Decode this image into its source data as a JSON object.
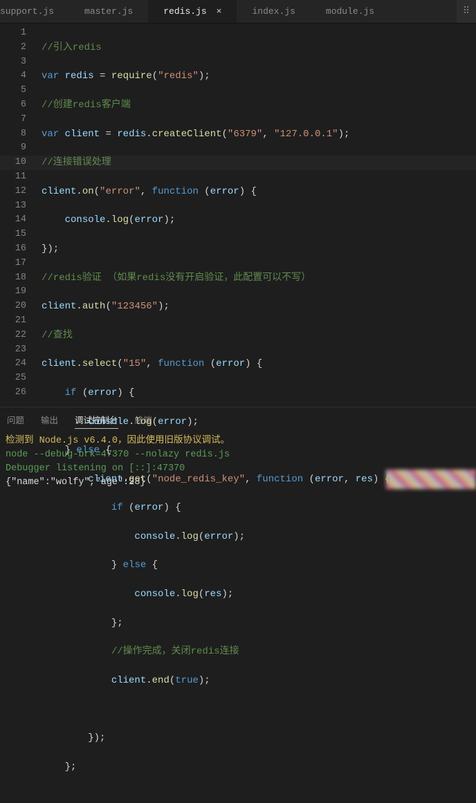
{
  "tabs": {
    "items": [
      {
        "label": "support.js"
      },
      {
        "label": "master.js"
      },
      {
        "label": "redis.js"
      },
      {
        "label": "index.js"
      },
      {
        "label": "module.js"
      }
    ],
    "active_index": 2,
    "close_glyph": "×",
    "drag_glyph": "⠿"
  },
  "editor": {
    "line_numbers": [
      "1",
      "2",
      "3",
      "4",
      "5",
      "6",
      "7",
      "8",
      "9",
      "10",
      "11",
      "12",
      "13",
      "14",
      "15",
      "16",
      "17",
      "18",
      "19",
      "20",
      "21",
      "22",
      "23",
      "24",
      "25",
      "26"
    ],
    "highlight_line": 10,
    "code": {
      "l1": {
        "comment": "//引入redis"
      },
      "l2": {
        "kw1": "var",
        "var": "redis",
        "eq": " = ",
        "fn": "require",
        "open": "(",
        "str": "\"redis\"",
        "close": ");"
      },
      "l3": {
        "comment": "//创建redis客户端"
      },
      "l4": {
        "kw1": "var",
        "var": "client",
        "eq": " = ",
        "obj": "redis",
        "dot": ".",
        "fn": "createClient",
        "open": "(",
        "str1": "\"6379\"",
        "comma": ", ",
        "str2": "\"127.0.0.1\"",
        "close": ");"
      },
      "l5": {
        "comment": "//连接错误处理"
      },
      "l6": {
        "obj": "client",
        "dot": ".",
        "fn": "on",
        "open": "(",
        "str": "\"error\"",
        "comma": ", ",
        "kw": "function",
        "sp": " (",
        "arg": "error",
        "close": ") {"
      },
      "l7": {
        "obj": "console",
        "dot": ".",
        "fn": "log",
        "open": "(",
        "arg": "error",
        "close": ");"
      },
      "l8": {
        "txt": "});"
      },
      "l9": {
        "comment": "//redis验证 （如果redis没有开启验证，此配置可以不写）"
      },
      "l10": {
        "obj": "client",
        "dot": ".",
        "fn": "auth",
        "open": "(",
        "str": "\"123456\"",
        "close": ");"
      },
      "l11": {
        "comment": "//查找"
      },
      "l12": {
        "obj": "client",
        "dot": ".",
        "fn": "select",
        "open": "(",
        "str": "\"15\"",
        "comma": ", ",
        "kw": "function",
        "sp": " (",
        "arg": "error",
        "close": ") {"
      },
      "l13": {
        "kw": "if",
        "sp": " (",
        "arg": "error",
        "close": ") {"
      },
      "l14": {
        "obj": "console",
        "dot": ".",
        "fn": "log",
        "open": "(",
        "arg": "error",
        "close": ");"
      },
      "l15": {
        "close": "} ",
        "kw": "else",
        "open": " {"
      },
      "l16": {
        "obj": "client",
        "dot": ".",
        "fn": "get",
        "open": "(",
        "str": "\"node_redis_key\"",
        "comma": ", ",
        "kw": "function",
        "sp": " (",
        "arg1": "error",
        "c2": ", ",
        "arg2": "res",
        "close": ") {"
      },
      "l17": {
        "kw": "if",
        "sp": " (",
        "arg": "error",
        "close": ") {"
      },
      "l18": {
        "obj": "console",
        "dot": ".",
        "fn": "log",
        "open": "(",
        "arg": "error",
        "close": ");"
      },
      "l19": {
        "close": "} ",
        "kw": "else",
        "open": " {"
      },
      "l20": {
        "obj": "console",
        "dot": ".",
        "fn": "log",
        "open": "(",
        "arg": "res",
        "close": ");"
      },
      "l21": {
        "txt": "};"
      },
      "l22": {
        "comment": "//操作完成，关闭redis连接"
      },
      "l23": {
        "obj": "client",
        "dot": ".",
        "fn": "end",
        "open": "(",
        "arg": "true",
        "close": ");"
      },
      "l24": {
        "txt": ""
      },
      "l25": {
        "txt": "});"
      },
      "l26": {
        "txt": "};"
      }
    }
  },
  "panel": {
    "tabs": [
      "问题",
      "输出",
      "调试控制台",
      "终端"
    ],
    "active_index": 2,
    "output": {
      "line1": "检测到 Node.js v6.4.0，因此使用旧版协议调试。",
      "line2": "node --debug-brk=47370 --nolazy redis.js",
      "line3": "Debugger listening on [::]:47370",
      "line4": "{\"name\":\"wolfy\",\"age\":28}"
    }
  }
}
